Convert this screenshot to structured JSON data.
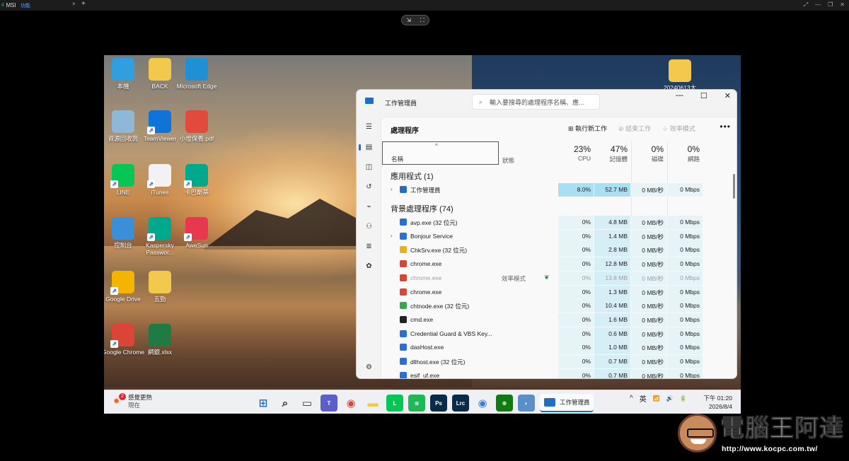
{
  "viewer": {
    "tab_title": "MSI",
    "tab_subtitle": "功能",
    "tab_close": "×",
    "new_tab": "+",
    "float_buttons": [
      "⇲",
      "⛶"
    ],
    "window_controls": [
      "⤢",
      "—",
      "❐",
      "✕"
    ]
  },
  "desktop_icons": [
    {
      "label": "本機",
      "icon": "monitor-icon",
      "color": "#2f9fe0"
    },
    {
      "label": "BACK",
      "icon": "folder-icon",
      "color": "#f2c94c"
    },
    {
      "label": "Microsoft Edge",
      "icon": "edge-icon",
      "color": "#1f8fd6"
    },
    {
      "label": "資源回收筒",
      "icon": "recycle-bin-icon",
      "color": "#8fb8d8"
    },
    {
      "label": "TeamViewer",
      "icon": "teamviewer-icon",
      "color": "#0e74d9"
    },
    {
      "label": "小燈保養.pdf",
      "icon": "pdf-icon",
      "color": "#e24a3b"
    },
    {
      "label": "LINE",
      "icon": "line-icon",
      "color": "#06c755"
    },
    {
      "label": "iTunes",
      "icon": "itunes-icon",
      "color": "#f2f2f2"
    },
    {
      "label": "卡巴斯基",
      "icon": "kaspersky-icon",
      "color": "#00a88e"
    },
    {
      "label": "控制台",
      "icon": "control-panel-icon",
      "color": "#3b8fd8"
    },
    {
      "label": "Kaspersky Passwor...",
      "icon": "kaspersky-password-icon",
      "color": "#00a88e"
    },
    {
      "label": "AweSun",
      "icon": "awesun-icon",
      "color": "#e8384f"
    },
    {
      "label": "Google Drive",
      "icon": "google-drive-icon",
      "color": "#f4b400"
    },
    {
      "label": "五勁",
      "icon": "folder-icon",
      "color": "#f2c94c"
    },
    {
      "label": "Google Chrome",
      "icon": "chrome-icon",
      "color": "#db4437"
    },
    {
      "label": "網銀.xlsx",
      "icon": "excel-icon",
      "color": "#1f7a44"
    },
    {
      "label": "20240613大",
      "icon": "folder-icon",
      "color": "#f2c94c"
    }
  ],
  "taskmgr": {
    "title": "工作管理員",
    "search_placeholder": "輸入要搜尋的處理程序名稱、應...",
    "window_buttons": [
      "—",
      "☐",
      "✕"
    ],
    "page_heading": "處理程序",
    "actions": {
      "run": "執行新工作",
      "end": "結束工作",
      "efficiency": "效率模式",
      "more": "•••"
    },
    "columns": {
      "name": "名稱",
      "status": "狀態",
      "cpu": {
        "pct": "23%",
        "label": "CPU"
      },
      "mem": {
        "pct": "47%",
        "label": "記憶體"
      },
      "disk": {
        "pct": "0%",
        "label": "磁碟"
      },
      "net": {
        "pct": "0%",
        "label": "網路"
      }
    },
    "apps_group": "應用程式 (1)",
    "bg_group": "背景處理程序 (74)",
    "apps": [
      {
        "name": "工作管理員",
        "expand": "›",
        "icon": "taskmgr-icon",
        "color": "#1f6fc5",
        "cpu": "8.0%",
        "mem": "52.7 MB",
        "disk": "0 MB/秒",
        "net": "0 Mbps"
      }
    ],
    "processes": [
      {
        "name": "avp.exe (32 位元)",
        "expand": "",
        "color": "#2a6fd6",
        "status": "",
        "cpu": "0%",
        "mem": "4.8 MB",
        "disk": "0 MB/秒",
        "net": "0 Mbps",
        "dim": false
      },
      {
        "name": "Bonjour Service",
        "expand": "›",
        "color": "#2a6fd6",
        "status": "",
        "cpu": "0%",
        "mem": "1.4 MB",
        "disk": "0 MB/秒",
        "net": "0 Mbps",
        "dim": false
      },
      {
        "name": "ChkSrv.exe (32 位元)",
        "expand": "",
        "color": "#e8b21f",
        "status": "",
        "cpu": "0%",
        "mem": "2.8 MB",
        "disk": "0 MB/秒",
        "net": "0 Mbps",
        "dim": false
      },
      {
        "name": "chrome.exe",
        "expand": "",
        "color": "#db4437",
        "status": "",
        "cpu": "0%",
        "mem": "12.8 MB",
        "disk": "0 MB/秒",
        "net": "0 Mbps",
        "dim": false
      },
      {
        "name": "chrome.exe",
        "expand": "",
        "color": "#db4437",
        "status": "效率模式",
        "cpu": "0%",
        "mem": "13.8 MB",
        "disk": "0 MB/秒",
        "net": "0 Mbps",
        "dim": true
      },
      {
        "name": "chrome.exe",
        "expand": "",
        "color": "#db4437",
        "status": "",
        "cpu": "0%",
        "mem": "1.3 MB",
        "disk": "0 MB/秒",
        "net": "0 Mbps",
        "dim": false
      },
      {
        "name": "chtnode.exe (32 位元)",
        "expand": "",
        "color": "#3aa650",
        "status": "",
        "cpu": "0%",
        "mem": "10.4 MB",
        "disk": "0 MB/秒",
        "net": "0 Mbps",
        "dim": false
      },
      {
        "name": "cmd.exe",
        "expand": "",
        "color": "#222222",
        "status": "",
        "cpu": "0%",
        "mem": "1.6 MB",
        "disk": "0 MB/秒",
        "net": "0 Mbps",
        "dim": false
      },
      {
        "name": "Credential Guard & VBS Key...",
        "expand": "",
        "color": "#2a6fd6",
        "status": "",
        "cpu": "0%",
        "mem": "0.6 MB",
        "disk": "0 MB/秒",
        "net": "0 Mbps",
        "dim": false
      },
      {
        "name": "dasHost.exe",
        "expand": "",
        "color": "#2a6fd6",
        "status": "",
        "cpu": "0%",
        "mem": "1.0 MB",
        "disk": "0 MB/秒",
        "net": "0 Mbps",
        "dim": false
      },
      {
        "name": "dllhost.exe (32 位元)",
        "expand": "",
        "color": "#2a6fd6",
        "status": "",
        "cpu": "0%",
        "mem": "0.7 MB",
        "disk": "0 MB/秒",
        "net": "0 Mbps",
        "dim": false
      },
      {
        "name": "esif_uf.exe",
        "expand": "",
        "color": "#2a6fd6",
        "status": "",
        "cpu": "0%",
        "mem": "0.7 MB",
        "disk": "0 MB/秒",
        "net": "0 Mbps",
        "dim": false
      }
    ],
    "rail_icons": [
      "menu-icon",
      "processes-icon",
      "performance-icon",
      "app-history-icon",
      "startup-icon",
      "users-icon",
      "details-icon",
      "services-icon",
      "settings-icon"
    ]
  },
  "taskbar": {
    "weather_badge": "2",
    "weather_title": "感覺更熱",
    "weather_sub": "現在",
    "apps": [
      {
        "name": "start-icon",
        "glyph": "⊞",
        "color": "#1f6fc5"
      },
      {
        "name": "search-icon",
        "glyph": "⌕",
        "color": "#222222"
      },
      {
        "name": "task-view-icon",
        "glyph": "▭",
        "color": "#333333"
      },
      {
        "name": "teams-icon",
        "glyph": "T",
        "color": "#5b5fc7"
      },
      {
        "name": "chrome-icon",
        "glyph": "◉",
        "color": "#db4437"
      },
      {
        "name": "file-explorer-icon",
        "glyph": "▬",
        "color": "#f2c94c"
      },
      {
        "name": "line-icon",
        "glyph": "L",
        "color": "#06c755"
      },
      {
        "name": "spotify-icon",
        "glyph": "≋",
        "color": "#1db954"
      },
      {
        "name": "photoshop-icon",
        "glyph": "Ps",
        "color": "#0a2a4a"
      },
      {
        "name": "lightroom-icon",
        "glyph": "Lrc",
        "color": "#0a2a4a"
      },
      {
        "name": "chrome-alt-icon",
        "glyph": "◉",
        "color": "#3a7bd5"
      },
      {
        "name": "xbox-icon",
        "glyph": "⊗",
        "color": "#107c10"
      },
      {
        "name": "app-icon",
        "glyph": "◐",
        "color": "#5a8fc8"
      }
    ],
    "active_label": "工作管理員",
    "tray": {
      "chevron": "^",
      "ime": "英",
      "wifi": "📶",
      "volume": "🔊",
      "battery": "🔋"
    },
    "time": "下午 01:20",
    "date": "2026/8/4"
  },
  "watermark": {
    "title": "電腦王阿達",
    "url": "http://www.kocpc.com.tw/"
  }
}
